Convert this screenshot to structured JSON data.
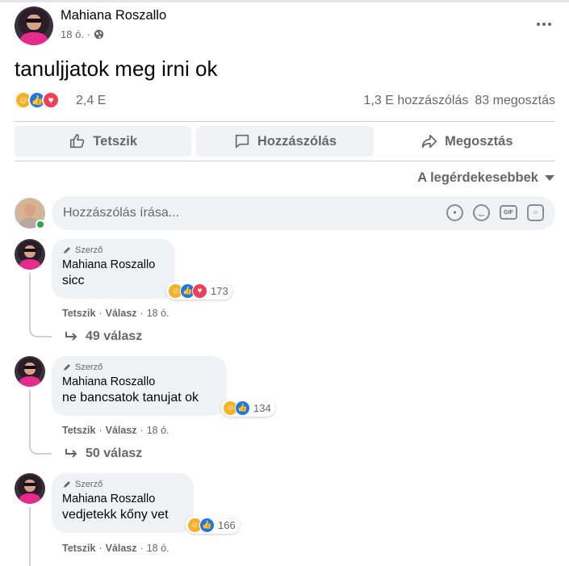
{
  "post": {
    "author": "Mahiana Roszallo",
    "time": "18 ó.",
    "separator": "·",
    "text": "tanuljjatok meg irni ok",
    "reaction_count": "2,4 E",
    "comments_count": "1,3 E hozzászólás",
    "shares_count": "83 megosztás"
  },
  "actions": {
    "like": "Tetszik",
    "comment": "Hozzászólás",
    "share": "Megosztás"
  },
  "sort": {
    "label": "A legérdekesebbek"
  },
  "composer": {
    "placeholder": "Hozzászólás írása...",
    "gif_label": "GIF"
  },
  "comments": [
    {
      "badge": "Szerző",
      "author": "Mahiana Roszallo",
      "text": "sicc",
      "reaction_count": "173",
      "like": "Tetszik",
      "reply": "Válasz",
      "time": "18 ó.",
      "replies": "49 válasz"
    },
    {
      "badge": "Szerző",
      "author": "Mahiana Roszallo",
      "text": "ne bancsatok tanujat ok",
      "reaction_count": "134",
      "like": "Tetszik",
      "reply": "Válasz",
      "time": "18 ó.",
      "replies": "50 válasz"
    },
    {
      "badge": "Szerző",
      "author": "Mahiana Roszallo",
      "text": "vedjetekk kőny vet",
      "reaction_count": "166",
      "like": "Tetszik",
      "reply": "Válasz",
      "time": "18 ó."
    }
  ],
  "icons": {
    "more": "more-options-icon",
    "globe": "globe-icon",
    "haha": "haha-reaction-icon",
    "like": "like-reaction-icon",
    "love": "love-reaction-icon",
    "pen": "pen-icon",
    "reply_arrow": "reply-arrow-icon"
  },
  "colors": {
    "secondary_text": "#65676b",
    "bubble_bg": "#f0f2f5",
    "like_blue": "#1877f2",
    "haha_yellow": "#f7b125",
    "love_red": "#f33e58",
    "online_green": "#31a24c"
  }
}
